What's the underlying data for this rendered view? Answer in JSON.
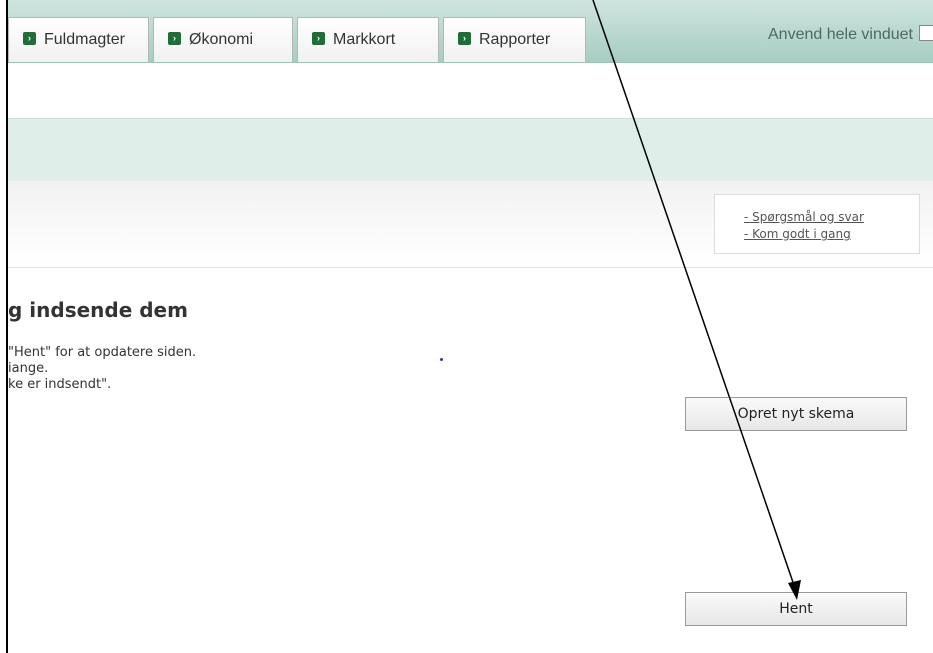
{
  "tabs": [
    {
      "label": "Fuldmagter",
      "icon": "arrow-right-icon"
    },
    {
      "label": "Økonomi",
      "icon": "arrow-right-icon"
    },
    {
      "label": "Markkort",
      "icon": "arrow-right-icon"
    },
    {
      "label": "Rapporter",
      "icon": "arrow-right-icon"
    }
  ],
  "fullwindow": {
    "label": "Anvend hele vinduet",
    "checked": false
  },
  "help": {
    "links": [
      "- Spørgsmål og svar",
      "- Kom godt i gang"
    ]
  },
  "content": {
    "heading": "g indsende dem",
    "lines": [
      " \"Hent\" for at opdatere siden.",
      "iange.",
      "ke er indsendt\"."
    ]
  },
  "buttons": {
    "create_label": "Opret nyt skema",
    "fetch_label": "Hent"
  },
  "colors": {
    "tabbar": "#a6cdc2",
    "band": "#e0eeea",
    "icon": "#1f6e3a"
  }
}
